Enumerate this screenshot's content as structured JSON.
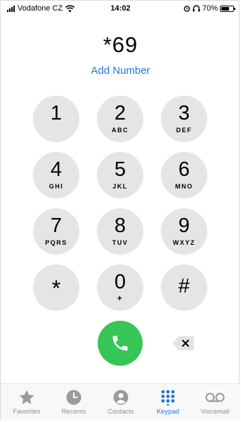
{
  "status_bar": {
    "carrier": "Vodafone CZ",
    "time": "14:02",
    "battery": "70%",
    "battery_level": 0.7,
    "icons": [
      "signal-icon",
      "wifi-icon",
      "alarm-icon",
      "headphones-icon",
      "battery-icon"
    ]
  },
  "dialer": {
    "number": "*69",
    "add_number": "Add Number"
  },
  "keypad": {
    "keys": [
      {
        "digit": "1",
        "letters": ""
      },
      {
        "digit": "2",
        "letters": "ABC"
      },
      {
        "digit": "3",
        "letters": "DEF"
      },
      {
        "digit": "4",
        "letters": "GHI"
      },
      {
        "digit": "5",
        "letters": "JKL"
      },
      {
        "digit": "6",
        "letters": "MNO"
      },
      {
        "digit": "7",
        "letters": "PQRS"
      },
      {
        "digit": "8",
        "letters": "TUV"
      },
      {
        "digit": "9",
        "letters": "WXYZ"
      },
      {
        "digit": "*",
        "letters": ""
      },
      {
        "digit": "0",
        "letters": "+"
      },
      {
        "digit": "#",
        "letters": ""
      }
    ]
  },
  "actions": {
    "call_icon": "phone-icon",
    "call_color": "#37c556",
    "backspace_icon": "backspace-icon"
  },
  "tabbar": {
    "active_color": "#1f7ad8",
    "inactive_color": "#8e8e93",
    "tabs": [
      {
        "label": "Favorites",
        "icon": "star-icon",
        "active": false
      },
      {
        "label": "Recents",
        "icon": "clock-icon",
        "active": false
      },
      {
        "label": "Contacts",
        "icon": "contact-icon",
        "active": false
      },
      {
        "label": "Keypad",
        "icon": "keypad-icon",
        "active": true
      },
      {
        "label": "Voicemail",
        "icon": "voicemail-icon",
        "active": false
      }
    ]
  }
}
